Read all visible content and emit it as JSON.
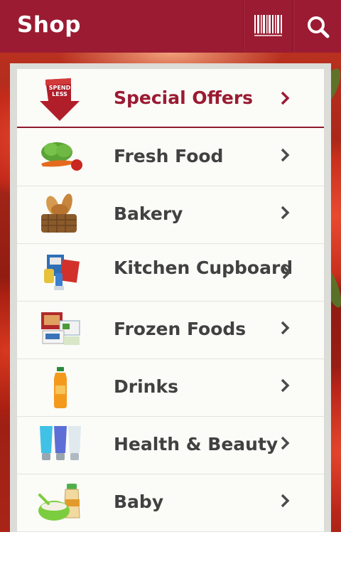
{
  "header": {
    "title": "Shop",
    "barcode_icon": "barcode-icon",
    "search_icon": "search-icon",
    "color": "#9a1b32"
  },
  "categories": [
    {
      "label": "Special Offers",
      "icon": "spend-less-arrow-icon",
      "highlight": true
    },
    {
      "label": "Fresh Food",
      "icon": "fresh-food-icon"
    },
    {
      "label": "Bakery",
      "icon": "bread-basket-icon"
    },
    {
      "label": "Kitchen Cupboard",
      "icon": "cupboard-groceries-icon"
    },
    {
      "label": "Frozen Foods",
      "icon": "frozen-food-icon"
    },
    {
      "label": "Drinks",
      "icon": "juice-bottle-icon"
    },
    {
      "label": "Health & Beauty",
      "icon": "cosmetic-tubes-icon"
    },
    {
      "label": "Baby",
      "icon": "baby-food-icon"
    }
  ],
  "special_offers_badge": "SPEND LESS",
  "colors": {
    "accent": "#9a1b32",
    "text": "#414141",
    "chevron": "#4a4a4a"
  }
}
